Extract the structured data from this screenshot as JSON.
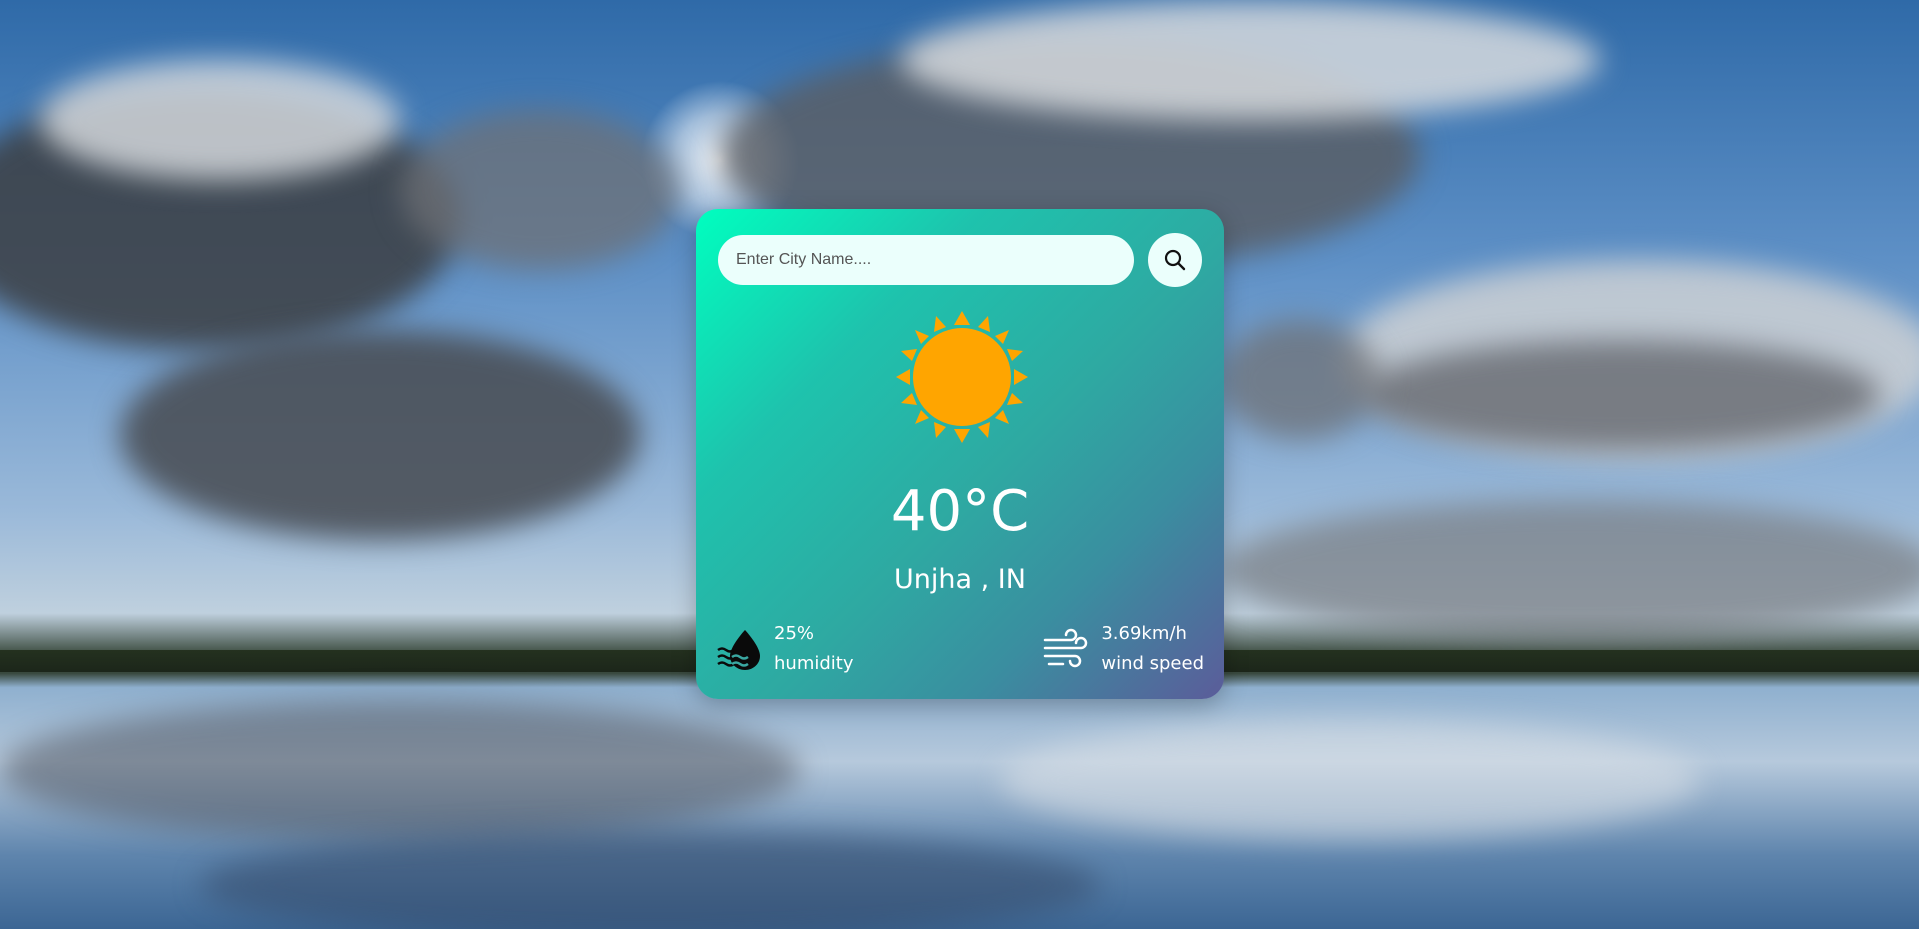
{
  "search": {
    "placeholder": "Enter City Name....",
    "value": ""
  },
  "weather": {
    "condition_icon": "sun-icon",
    "temperature": "40°C",
    "city": "Unjha , IN",
    "humidity_value": "25%",
    "humidity_label": "humidity",
    "humidity_icon": "humidity-drop-icon",
    "wind_value": "3.69km/h",
    "wind_label": "wind speed",
    "wind_icon": "wind-icon"
  },
  "colors": {
    "card_gradient_start": "#00ffbf",
    "card_gradient_end": "#5b5c9a",
    "sun": "#ffa500",
    "input_bg": "#ebfffc",
    "text": "#ffffff"
  }
}
